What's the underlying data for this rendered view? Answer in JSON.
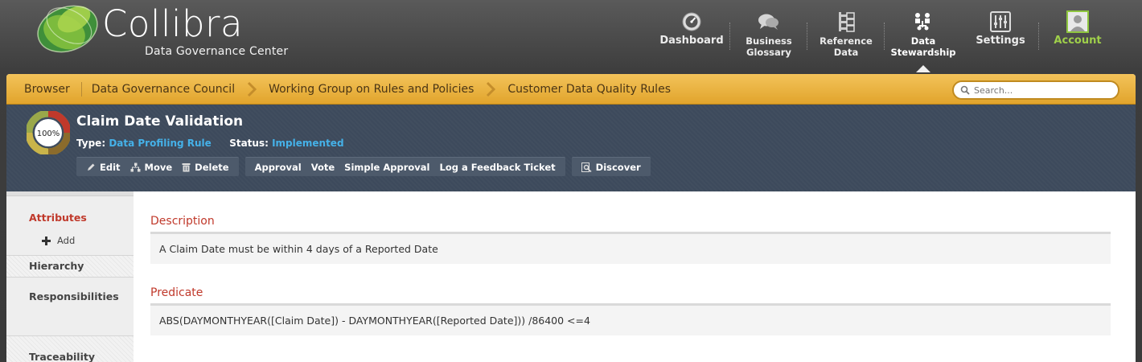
{
  "brand": {
    "name": "Collibra",
    "subtitle": "Data Governance Center"
  },
  "nav": [
    {
      "id": "dashboard",
      "label": "Dashboard",
      "icon": "gauge-icon"
    },
    {
      "id": "business-glossary",
      "label": "Business\nGlossary",
      "icon": "speech-bubbles-icon"
    },
    {
      "id": "reference-data",
      "label": "Reference\nData",
      "icon": "tree-structure-icon"
    },
    {
      "id": "data-stewardship",
      "label": "Data\nStewardship",
      "icon": "org-chart-icon",
      "active": true
    },
    {
      "id": "settings",
      "label": "Settings",
      "icon": "sliders-icon"
    },
    {
      "id": "account",
      "label": "Account",
      "icon": "user-avatar-icon"
    }
  ],
  "breadcrumb": {
    "root": "Browser",
    "items": [
      "Data Governance Council",
      "Working Group on Rules and Policies",
      "Customer Data Quality Rules"
    ]
  },
  "search": {
    "placeholder": "Search..."
  },
  "asset": {
    "completeness": "100%",
    "completeness_fraction": 1.0,
    "title": "Claim Date Validation",
    "type_label": "Type:",
    "type_value": "Data Profiling Rule",
    "status_label": "Status:",
    "status_value": "Implemented"
  },
  "actions": {
    "edit": "Edit",
    "move": "Move",
    "delete": "Delete",
    "approval": "Approval",
    "vote": "Vote",
    "simple_approval": "Simple Approval",
    "feedback": "Log a Feedback Ticket",
    "discover": "Discover"
  },
  "sidebar": {
    "attributes": "Attributes",
    "add": "Add",
    "hierarchy": "Hierarchy",
    "responsibilities": "Responsibilities",
    "traceability": "Traceability"
  },
  "content": {
    "description_title": "Description",
    "description": "A Claim Date must be within 4 days of a Reported Date",
    "predicate_title": "Predicate",
    "predicate": "ABS(DAYMONTHYEAR([Claim Date]) - DAYMONTHYEAR([Reported Date])) /86400 <=4"
  },
  "colors": {
    "accent_orange": "#e8ad36",
    "header_navy": "#3d4a5c",
    "link_blue": "#45b1e8",
    "section_red": "#c0392b",
    "account_green": "#9fcf4a"
  }
}
